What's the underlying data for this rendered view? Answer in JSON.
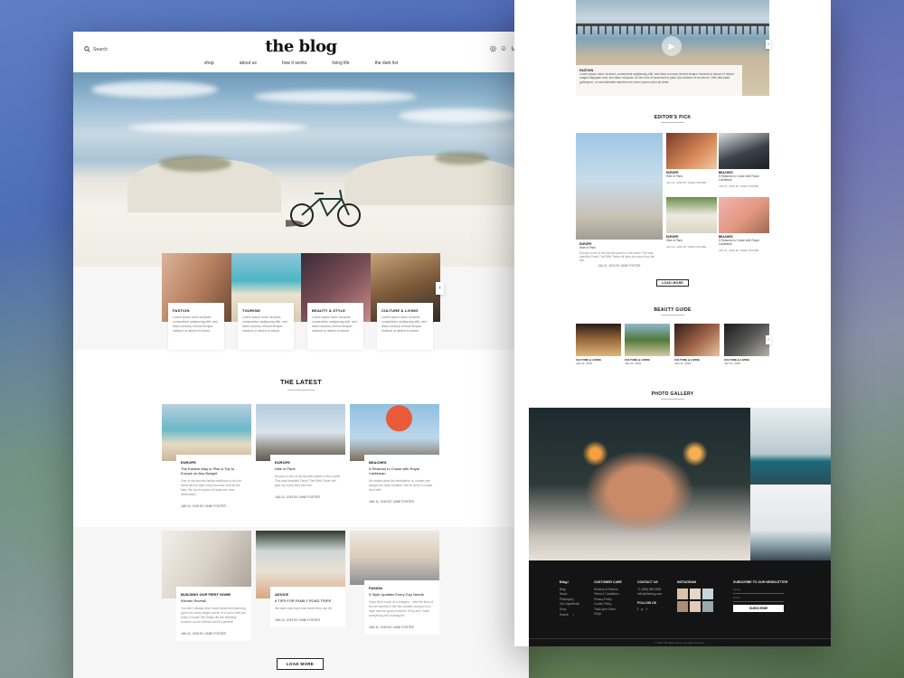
{
  "header": {
    "search_label": "Search",
    "logo": "the blog",
    "nav": [
      "shop",
      "about us",
      "how it works",
      "living life",
      "the dark list"
    ]
  },
  "categories": [
    {
      "title": "FASTION",
      "desc": "Lorem ipsum dolor sit amet, consectetur sadipscing elitr, sed diam nonumy eirmod tempor invidunt ut labore et dolore"
    },
    {
      "title": "TOURISM",
      "desc": "Lorem ipsum dolor sit amet, consectetur sadipscing elitr, sed diam nonumy eirmod tempor invidunt ut labore et dolore"
    },
    {
      "title": "BEAUTY & STYLE",
      "desc": "Lorem ipsum dolor sit amet, consectetur sadipscing elitr, sed diam nonumy eirmod tempor invidunt ut labore et dolore"
    },
    {
      "title": "CULTURE & LIVING",
      "desc": "Lorem ipsum dolor sit amet, consectetur sadipscing elitr, sed diam nonumy eirmod tempor invidunt ut labore et dolore"
    }
  ],
  "latest": {
    "title": "THE LATEST",
    "load_more": "LOAD MORE",
    "posts": [
      {
        "cat": "EUROPE",
        "title": "The Easiest Way to Plan a Trip to Europe on Any Budget",
        "excerpt": "One of my favorite family traditions is our fun week trip we take every summer with all the kids. We try to explore at least one new destination.",
        "meta": "JAN 11, 2019 BY JANE FOSTER"
      },
      {
        "cat": "EUROPE",
        "title": "Hike in Paris",
        "excerpt": "Europe is one of my favorite places in the world! This was beautiful Paris! The Eiffel Tower will give my every time like this.",
        "meta": "JAN 11, 2019 BY JANE FOSTER"
      },
      {
        "cat": "BEACHES",
        "title": "5 Reasons to Cruise with Royal Caribbean",
        "excerpt": "No matter what the destination is, cruises are always the best vacation! We've done a couple then with",
        "meta": "JAN 11, 2019 BY JANE FOSTER"
      },
      {
        "cat": "BUILDING OUR FIRST HOME",
        "title": "Kitchen Reveal!",
        "excerpt": "You don't always hear much detail and planning goes into every single corner of a room until you build a house! We finally did the finishing touches on our kitchen and it's perfect!",
        "meta": "JAN 11, 2019 BY JANE FOSTER"
      },
      {
        "cat": "ADVICE",
        "title": "6 TIPS FOR FAMILY ROAD TRIPS",
        "excerpt": "We take road trips road travel they can be...",
        "meta": "JAN 11, 2019 BY JANE FOSTER"
      },
      {
        "cat": "FASION",
        "title": "5 Style Updates Every Guy Needs",
        "excerpt": "Guys don't much of a shopper - with the kind of fun be carefull in the 4th minutes and just of a style and the guys involved. I'll try and I have everything he's looking for.",
        "meta": "JAN 11, 2019 BY JANE FOSTER"
      }
    ]
  },
  "video": {
    "label": "FASTION",
    "caption": "Lorem ipsum dolor sit amet, consectetur sadipscing elitr, sed diam nonumy eirmod tempor invidunt ut labore et dolore magna aliquyam erat, sed diam voluptua. At vero eos et accusam et justo duo dolores et ea rebum. Stet clita kasd gubergren, no sea takimata sanctus est Lorem ipsum dolor sit amet."
  },
  "editors_pick": {
    "title": "EDITOR'S PICK",
    "load_more": "LOAD MORE",
    "big": {
      "cat": "EUROPE",
      "title": "Hike in Paris",
      "excerpt": "Europe is one of my favorite places in the world! This was beautiful Paris! The Eiffel Tower will give my every time like this.",
      "meta": "JAN 11, 2019 BY JANE FOSTER"
    },
    "items": [
      {
        "cat": "EUROPE",
        "title": "Hike in Paris",
        "meta": "JAN 11, 2019 BY JANE FOSTER"
      },
      {
        "cat": "BEACHES",
        "title": "5 Reasons to Cruise with Royal Caribbean",
        "meta": "JAN 11, 2019 BY JANE FOSTER"
      },
      {
        "cat": "EUROPE",
        "title": "Hike in Paris",
        "meta": "JAN 11, 2019 BY JANE FOSTER"
      },
      {
        "cat": "BEACHES",
        "title": "5 Reasons to Cruise with Royal Caribbean",
        "meta": "JAN 11, 2019 BY JANE FOSTER"
      }
    ]
  },
  "beauty_guide": {
    "title": "BEAUTY GUIDE",
    "items": [
      {
        "cat": "CULTURE & LIVING",
        "title": "JAN 11, 2019"
      },
      {
        "cat": "CULTURE & LIVING",
        "title": "JAN 11, 2019"
      },
      {
        "cat": "CULTURE & LIVING",
        "title": "JAN 11, 2019"
      },
      {
        "cat": "CULTURE & LIVING",
        "title": "JAN 11, 2019"
      }
    ]
  },
  "photo_gallery": {
    "title": "PHOTO GALLERY"
  },
  "footer": {
    "brand": "blog!",
    "links": [
      "Blog",
      "About",
      "Philosophy",
      "Our Ingredients",
      "Shop"
    ],
    "customer_care": {
      "h": "CUSTOMER CARE",
      "items": [
        "Delivery & Returns",
        "Terms & Conditions",
        "Privacy Policy",
        "Cookie Policy",
        "Track your Order",
        "FAQs"
      ]
    },
    "contact": {
      "h": "CONTACT US",
      "items": [
        "+1 (555) 555 5555",
        "hello@theblog.com"
      ],
      "follow": "FOLLOW US"
    },
    "instagram": "INSTAGRAM",
    "newsletter": {
      "h": "SUBSCRIBE TO OUR NEWSLETTER",
      "name_ph": "Name",
      "email_ph": "Email",
      "button": "SUBSCRIBE"
    },
    "copyright": "© 2019 The Blog Theme. All rights reserved."
  }
}
